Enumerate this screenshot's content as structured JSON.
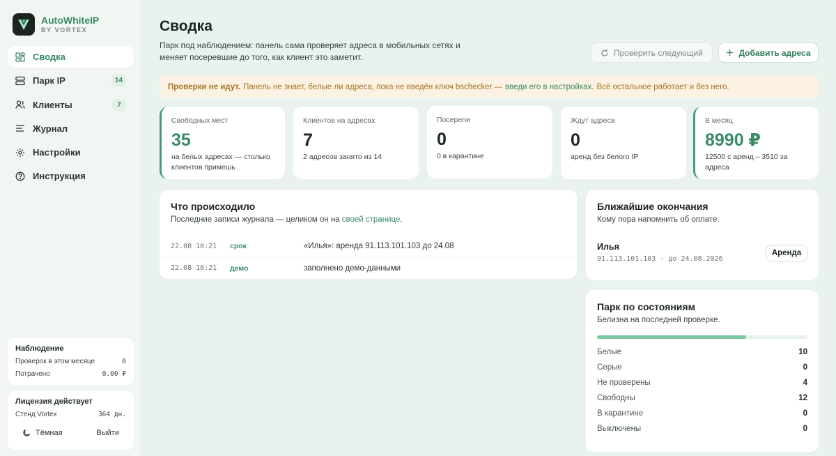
{
  "brand": {
    "name": "AutoWhiteIP",
    "sub": "BY VORTEX"
  },
  "nav": [
    {
      "label": "Сводка",
      "icon": "dashboard-icon",
      "active": true,
      "badge": ""
    },
    {
      "label": "Парк IP",
      "icon": "server-icon",
      "active": false,
      "badge": "14"
    },
    {
      "label": "Клиенты",
      "icon": "users-icon",
      "active": false,
      "badge": "7"
    },
    {
      "label": "Журнал",
      "icon": "list-icon",
      "active": false,
      "badge": ""
    },
    {
      "label": "Настройки",
      "icon": "gear-icon",
      "active": false,
      "badge": ""
    },
    {
      "label": "Инструкция",
      "icon": "help-icon",
      "active": false,
      "badge": ""
    }
  ],
  "monitor": {
    "title": "Наблюдение",
    "checks_label": "Проверок в этом месяце",
    "checks_value": "0",
    "spent_label": "Потрачено",
    "spent_value": "0.00 ₽"
  },
  "license": {
    "title": "Лицензия действует",
    "stand_label": "Стенд Vortex",
    "stand_value": "364 дн.",
    "theme_label": "Тёмная",
    "logout_label": "Выйти"
  },
  "header": {
    "title": "Сводка",
    "desc": "Парк под наблюдением: панель сама проверяет адреса в мобильных сетях и меняет посеревшие до того, как клиент это заметит.",
    "check_next": "Проверить следующий",
    "add_addresses": "Добавить адреса"
  },
  "warning": {
    "bold": "Проверки не идут.",
    "text1": "Панель не знает, белые ли адреса, пока не введён ключ bschecker —",
    "link": "введи его в настройках.",
    "text2": "Всё остальное работает и без него."
  },
  "stats": [
    {
      "label": "Свободных мест",
      "value": "35",
      "sub": "на белых адресах — столько клиентов примешь",
      "accent": true
    },
    {
      "label": "Клиентов на адресах",
      "value": "7",
      "sub": "2 адресов занято из 14",
      "accent": false
    },
    {
      "label": "Посерели",
      "value": "0",
      "sub": "0 в карантине",
      "accent": false
    },
    {
      "label": "Ждут адреса",
      "value": "0",
      "sub": "аренд без белого IP",
      "accent": false
    },
    {
      "label": "В месяц",
      "value": "8990 ₽",
      "sub": "12500 с аренд – 3510 за адреса",
      "accent": true
    }
  ],
  "events": {
    "title": "Что происходило",
    "sub_text": "Последние записи журнала — целиком он на",
    "sub_link": "своей странице",
    "sub_end": ".",
    "rows": [
      {
        "time": "22.08 10:21",
        "tag": "срок",
        "text": "«Илья»: аренда 91.113.101.103 до 24.08"
      },
      {
        "time": "22.08 10:21",
        "tag": "демо",
        "text": "заполнено демо-данными"
      }
    ]
  },
  "endings": {
    "title": "Ближайшие окончания",
    "sub": "Кому пора напомнить об оплате.",
    "client": "Илья",
    "detail": "91.113.101.103 · до 24.08.2026",
    "pill": "Аренда"
  },
  "park": {
    "title": "Парк по состояниям",
    "sub": "Белизна на последней проверке.",
    "progress_fraction": 0.71,
    "rows": [
      {
        "label": "Белые",
        "value": "10"
      },
      {
        "label": "Серые",
        "value": "0"
      },
      {
        "label": "Не проверены",
        "value": "4"
      },
      {
        "label": "Свободны",
        "value": "12"
      },
      {
        "label": "В карантине",
        "value": "0"
      },
      {
        "label": "Выключены",
        "value": "0"
      }
    ]
  }
}
